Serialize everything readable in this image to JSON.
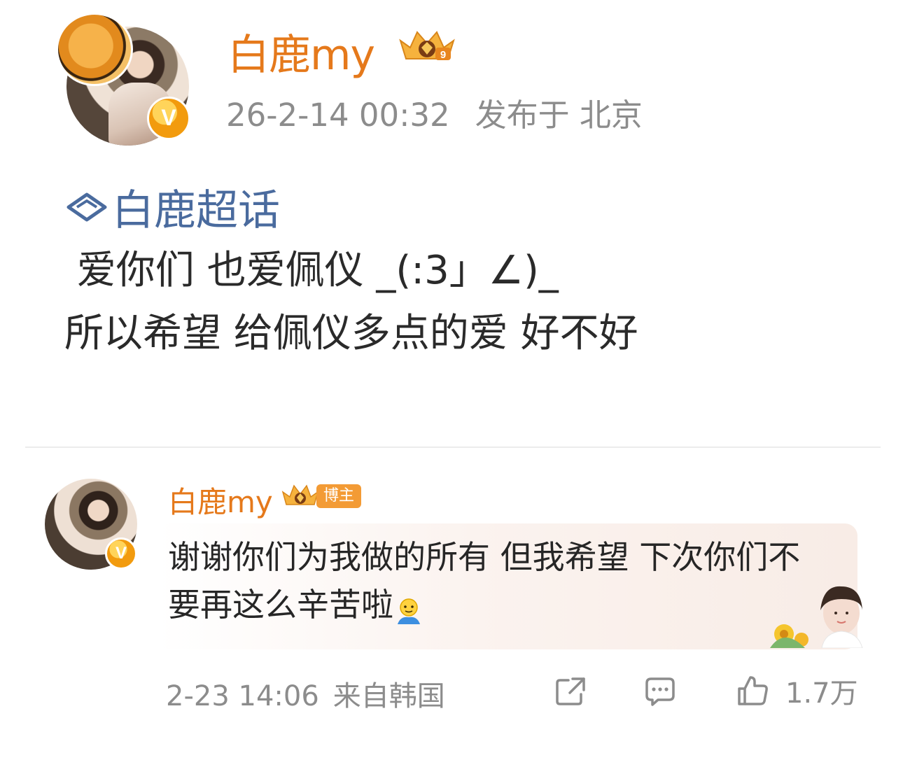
{
  "post": {
    "author": "白鹿my",
    "time": "26-2-14 00:32",
    "location": "发布于 北京",
    "topic": "白鹿超话",
    "lines": [
      " 爱你们 也爱佩仪 _(:3」∠)_",
      "所以希望 给佩仪多点的爱 好不好"
    ]
  },
  "comment": {
    "author": "白鹿my",
    "badge_label": "博主",
    "text": "谢谢你们为我做的所有 但我希望 下次你们不要再这么辛苦啦",
    "time": "2-23 14:06",
    "source": "来自韩国",
    "likes": "1.7万"
  },
  "colors": {
    "author": "#e5791b",
    "topic": "#4a6b9e",
    "meta": "#8c8c8c"
  },
  "icons": {
    "post_badge": "verified-v-icon",
    "crown": "crown-level-9-icon",
    "topic": "diamond-super-topic-icon",
    "emoji": "shy-emoji-icon",
    "repost": "share-icon",
    "comment": "comment-icon",
    "like": "thumbs-up-icon"
  }
}
